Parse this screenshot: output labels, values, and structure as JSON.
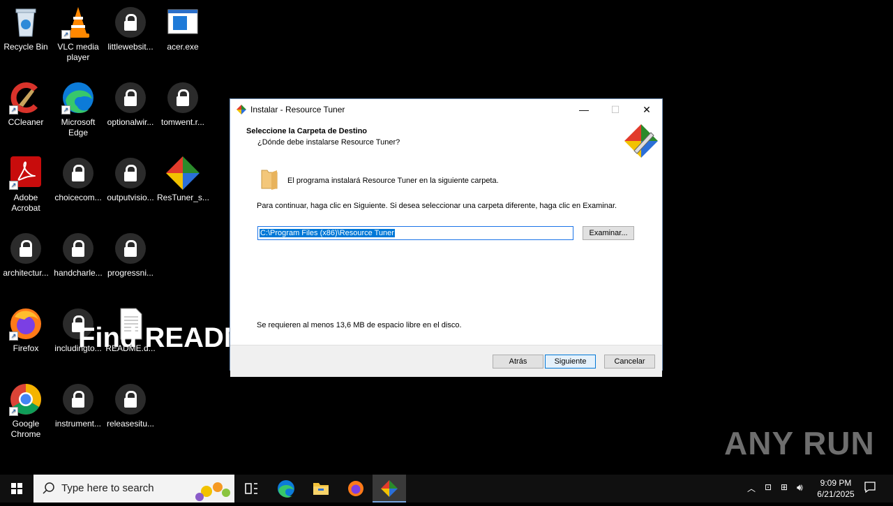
{
  "desktop": {
    "icons": [
      {
        "label": "Recycle Bin"
      },
      {
        "label": "VLC media player"
      },
      {
        "label": "littlewebsit..."
      },
      {
        "label": "acer.exe"
      },
      {
        "label": "CCleaner"
      },
      {
        "label": "Microsoft Edge"
      },
      {
        "label": "optionalwir..."
      },
      {
        "label": "tomwent.r..."
      },
      {
        "label": "Adobe Acrobat"
      },
      {
        "label": "choicecom..."
      },
      {
        "label": "outputvisio..."
      },
      {
        "label": "ResTuner_s..."
      },
      {
        "label": "architectur..."
      },
      {
        "label": "handcharle..."
      },
      {
        "label": "progressni..."
      },
      {
        "label": "Firefox"
      },
      {
        "label": "includingto..."
      },
      {
        "label": "README.d..."
      },
      {
        "label": "Google Chrome"
      },
      {
        "label": "instrument..."
      },
      {
        "label": "releasesitu..."
      }
    ],
    "wallpaper_text": "Find README.txt for instructions!",
    "watermark": "ANY RUN"
  },
  "dialog": {
    "title": "Instalar - Resource Tuner",
    "heading": "Seleccione la Carpeta de Destino",
    "subheading": "¿Dónde debe instalarse Resource Tuner?",
    "info_line": "El programa instalará Resource Tuner en la siguiente carpeta.",
    "instruction": "Para continuar, haga clic en Siguiente. Si desea seleccionar una carpeta diferente, haga clic en Examinar.",
    "path_value": "C:\\Program Files (x86)\\Resource Tuner",
    "browse_label": "Examinar...",
    "space_note": "Se requieren al menos 13,6 MB de espacio libre en el disco.",
    "back_label": "Atrás",
    "next_label": "Siguiente",
    "cancel_label": "Cancelar"
  },
  "taskbar": {
    "search_placeholder": "Type here to search",
    "time": "9:09 PM",
    "date": "6/21/2025"
  }
}
